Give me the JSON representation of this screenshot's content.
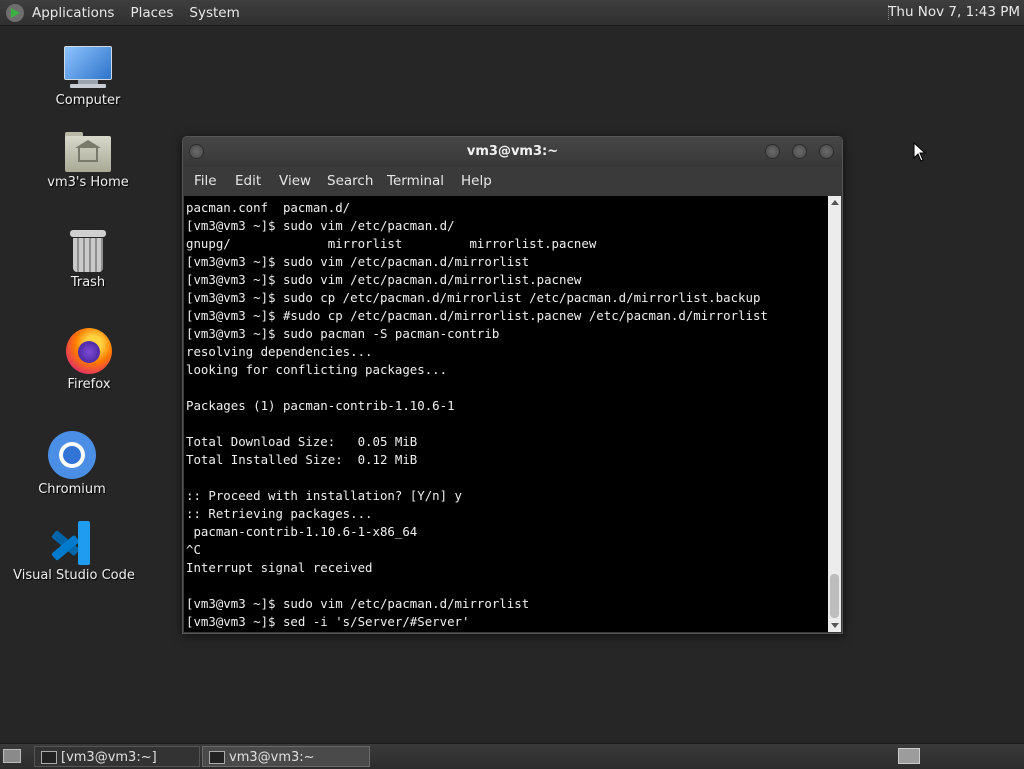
{
  "top_panel": {
    "menus": [
      "Applications",
      "Places",
      "System"
    ],
    "clock": "Thu Nov 7, 1:43 PM"
  },
  "desktop_icons": [
    {
      "label": "Computer",
      "icon": "computer-icon"
    },
    {
      "label": "vm3's Home",
      "icon": "home-folder-icon"
    },
    {
      "label": "Trash",
      "icon": "trash-icon"
    },
    {
      "label": "Firefox",
      "icon": "firefox-icon"
    },
    {
      "label": "Chromium",
      "icon": "chromium-icon"
    },
    {
      "label": "Visual Studio Code",
      "icon": "vscode-icon"
    }
  ],
  "terminal": {
    "title": "vm3@vm3:~",
    "menu": [
      "File",
      "Edit",
      "View",
      "Search",
      "Terminal",
      "Help"
    ],
    "lines": [
      "pacman.conf  pacman.d/",
      "[vm3@vm3 ~]$ sudo vim /etc/pacman.d/",
      "gnupg/             mirrorlist         mirrorlist.pacnew",
      "[vm3@vm3 ~]$ sudo vim /etc/pacman.d/mirrorlist",
      "[vm3@vm3 ~]$ sudo vim /etc/pacman.d/mirrorlist.pacnew",
      "[vm3@vm3 ~]$ sudo cp /etc/pacman.d/mirrorlist /etc/pacman.d/mirrorlist.backup",
      "[vm3@vm3 ~]$ #sudo cp /etc/pacman.d/mirrorlist.pacnew /etc/pacman.d/mirrorlist",
      "[vm3@vm3 ~]$ sudo pacman -S pacman-contrib",
      "resolving dependencies...",
      "looking for conflicting packages...",
      "",
      "Packages (1) pacman-contrib-1.10.6-1",
      "",
      "Total Download Size:   0.05 MiB",
      "Total Installed Size:  0.12 MiB",
      "",
      ":: Proceed with installation? [Y/n] y",
      ":: Retrieving packages...",
      " pacman-contrib-1.10.6-1-x86_64",
      "^C",
      "Interrupt signal received",
      "",
      "[vm3@vm3 ~]$ sudo vim /etc/pacman.d/mirrorlist",
      "[vm3@vm3 ~]$ sed -i 's/Server/#Server'"
    ]
  },
  "taskbar": {
    "tasks": [
      {
        "label": "[vm3@vm3:~]",
        "active": false
      },
      {
        "label": "vm3@vm3:~",
        "active": true
      }
    ]
  }
}
